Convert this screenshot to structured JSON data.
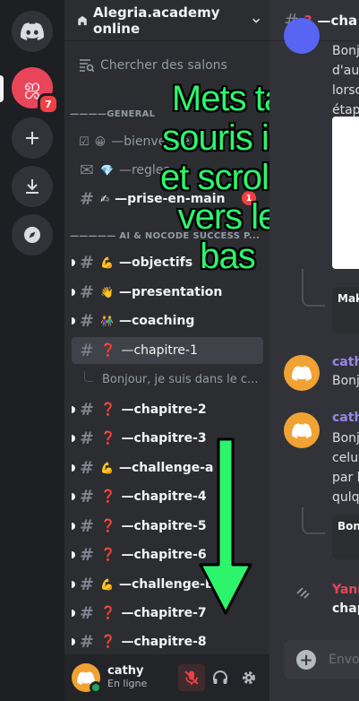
{
  "rail": {
    "alegria_badge": "7",
    "alegria_glyph": "ஜ"
  },
  "guild": {
    "name": "Alegria.academy online"
  },
  "browse": {
    "label": "Chercher des salons"
  },
  "categories": [
    {
      "label": "————GÉNÉRAL"
    },
    {
      "label": "————— AI & NOCODE SUCCESS P..."
    }
  ],
  "channels": [
    {
      "emoji": "😀",
      "name": "—bienvenue",
      "prefix": "✔"
    },
    {
      "emoji": "💎",
      "name": "—regles"
    },
    {
      "emoji": "✍",
      "name": "—prise-en-main"
    },
    {
      "emoji": "💪",
      "name": "—objectifs"
    },
    {
      "emoji": "👋",
      "name": "—presentation"
    },
    {
      "emoji": "👫",
      "name": "—coaching"
    },
    {
      "emoji": "❓",
      "name": "—chapitre-1"
    },
    {
      "emoji": "❓",
      "name": "—chapitre-2"
    },
    {
      "emoji": "❓",
      "name": "—chapitre-3"
    },
    {
      "emoji": "💪",
      "name": "—challenge-a"
    },
    {
      "emoji": "❓",
      "name": "—chapitre-4"
    },
    {
      "emoji": "❓",
      "name": "—chapitre-5"
    },
    {
      "emoji": "❓",
      "name": "—chapitre-6"
    },
    {
      "emoji": "💪",
      "name": "—challenge-b"
    },
    {
      "emoji": "❓",
      "name": "—chapitre-7"
    },
    {
      "emoji": "❓",
      "name": "—chapitre-8"
    }
  ],
  "thread": {
    "label": "Bonjour, je suis dans le c..."
  },
  "sidebar_badge": "1",
  "user": {
    "name": "cathy",
    "status": "En ligne"
  },
  "overlay": {
    "lines": [
      "Mets ta",
      "souris ici",
      "et scrolle",
      "vers le",
      "bas"
    ]
  },
  "chat": {
    "header": "—cha",
    "messages": [
      {
        "lines": [
          "Bonj",
          "d'aut",
          "lorsc",
          "étap"
        ]
      },
      {
        "name": "cath",
        "lines": [
          "Bonjo"
        ]
      },
      {
        "name": "cath",
        "lines": [
          "Bonj",
          "celul",
          "par l",
          "qulq"
        ]
      },
      {
        "name": "Yann",
        "lines": [
          "chap"
        ]
      }
    ],
    "thread_boxes": [
      "Mak",
      "Bon"
    ],
    "composer_placeholder": "Envo"
  },
  "colors": {
    "accent_red": "#e8455b",
    "overlay_green": "#2cf56c",
    "online_green": "#23a559",
    "avatar_orange": "#f0a232"
  }
}
